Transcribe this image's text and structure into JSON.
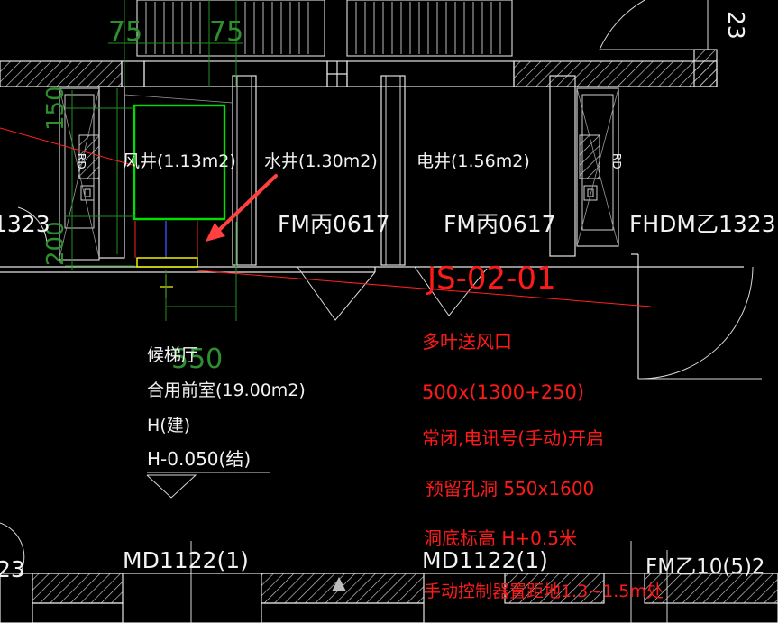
{
  "colors": {
    "background": "#000000",
    "walls": "#e6e6e6",
    "annotation_red": "#ff1a1a",
    "dimension_green": "#1f8f1f",
    "duct_green": "#00e000",
    "opening_yellow": "#ffff00",
    "arrow_red": "#ff3030"
  },
  "shafts": {
    "air": "风井(1.13m2)",
    "water": "水井(1.30m2)",
    "electric": "电井(1.56m2)"
  },
  "doors": {
    "fm1": "FM丙0617",
    "fm2": "FM丙0617",
    "fhdm": "FHDM乙1323",
    "left_code": "1323",
    "md_left": "MD1122(1)",
    "md_right": "MD1122(1)",
    "fm_right": "FM乙10(5)2",
    "left_bottom": "23",
    "top_right": "23"
  },
  "rd_labels": [
    "RD",
    "RD"
  ],
  "dimensions": {
    "top_left": "75",
    "top_right": "75",
    "side_150": "150",
    "side_200": "200",
    "width_550": "550"
  },
  "room": {
    "name": "候梯厅",
    "desc": "合用前室(19.00m2)",
    "level_arch": "H(建)",
    "level_struct": "H-0.050(结)"
  },
  "annotation": {
    "code": "JS-02-01",
    "lines": [
      "多叶送风口",
      "500x(1300+250)",
      "常闭,电讯号(手动)开启",
      "预留孔洞 550x1600",
      "洞底标高 H+0.5米",
      "手动控制器置距地1.3~1.5m处"
    ]
  }
}
